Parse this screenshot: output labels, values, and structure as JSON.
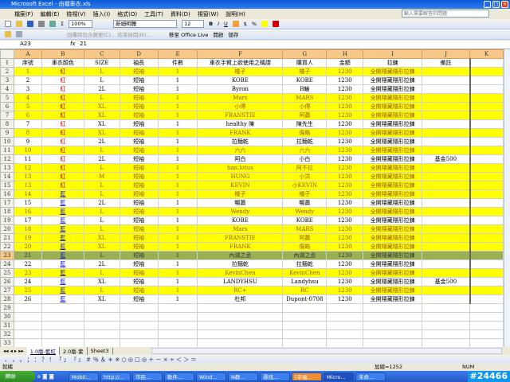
{
  "window": {
    "title": "Microsoft Excel - 由檔車衣.xls"
  },
  "menu": [
    "檔案(F)",
    "編輯(E)",
    "檢視(V)",
    "插入(I)",
    "格式(O)",
    "工具(T)",
    "資料(D)",
    "視窗(W)",
    "說明(H)"
  ],
  "ask_placeholder": "輸入需要解答的問題",
  "toolbar": {
    "zoom": "100%",
    "font": "新細明體",
    "size": "12",
    "bold": "B",
    "italic": "I",
    "underline": "U",
    "currency": "$",
    "percent": "%"
  },
  "toolbar2": {
    "reply": "回覆時包含變更(C)... 結束檢閱(N)...",
    "office_live": "移至 Office Live",
    "open": "開啟",
    "save": "儲存"
  },
  "formula_bar": {
    "cell_ref": "A23",
    "fx": "fx",
    "value": "21"
  },
  "columns": [
    "A",
    "B",
    "C",
    "D",
    "E",
    "F",
    "G",
    "H",
    "I",
    "J",
    "K"
  ],
  "headers": [
    "序號",
    "車衣顏色",
    "SIZE",
    "袖長",
    "件數",
    "車衣手臂上欲使用之稱謂",
    "購買人",
    "金額",
    "拉鍊",
    "備註"
  ],
  "rows": [
    [
      "1",
      "紅",
      "L",
      "短袖",
      "1",
      "橘子",
      "橘子",
      "1230",
      "全開隱藏隱形拉鍊",
      ""
    ],
    [
      "2",
      "紅",
      "L",
      "短袖",
      "1",
      "KOBE",
      "KOBE",
      "1230",
      "全開隱藏隱形拉鍊",
      ""
    ],
    [
      "3",
      "紅",
      "2L",
      "短袖",
      "1",
      "Byron",
      "B輪",
      "1230",
      "全開隱藏隱形拉鍊",
      ""
    ],
    [
      "4",
      "紅",
      "L",
      "短袖",
      "1",
      "Mars",
      "MARS",
      "1230",
      "全開隱藏隱形拉鍊",
      ""
    ],
    [
      "5",
      "紅",
      "XL",
      "短袖",
      "1",
      "小傅",
      "小傅",
      "1230",
      "全開隱藏隱形拉鍊",
      ""
    ],
    [
      "6",
      "紅",
      "XL",
      "短袖",
      "1",
      "FRANSTIE",
      "阿蕭",
      "1230",
      "全開隱藏隱形拉鍊",
      ""
    ],
    [
      "7",
      "紅",
      "XL",
      "短袖",
      "1",
      "healthy 陳",
      "陳先生",
      "1230",
      "全開隱藏隱形拉鍊",
      ""
    ],
    [
      "8",
      "紅",
      "XL",
      "短袖",
      "1",
      "FRANK",
      "傷皓",
      "1230",
      "全開隱藏隱形拉鍊",
      ""
    ],
    [
      "9",
      "紅",
      "2L",
      "短袖",
      "1",
      "拉麵乾",
      "拉麵乾",
      "1230",
      "全開隱藏隱形拉鍊",
      ""
    ],
    [
      "10",
      "紅",
      "L",
      "短袖",
      "1",
      "六六",
      "六六",
      "1230",
      "全開隱藏隱形拉鍊",
      ""
    ],
    [
      "11",
      "紅",
      "2L",
      "短袖",
      "1",
      "阿白",
      "小白",
      "1230",
      "全開隱藏隱形拉鍊",
      "基金500"
    ],
    [
      "12",
      "紅",
      "L",
      "短袖",
      "1",
      "han.lotus",
      "阿不拉",
      "1230",
      "全開隱藏隱形拉鍊",
      ""
    ],
    [
      "13",
      "紅",
      "M",
      "短袖",
      "1",
      "HUNG",
      "小洪",
      "1230",
      "全開隱藏隱形拉鍊",
      ""
    ],
    [
      "13",
      "紅",
      "L",
      "短袖",
      "1",
      "KEVIN",
      "小KEVIN",
      "1230",
      "全開隱藏隱形拉鍊",
      ""
    ],
    [
      "14",
      "藍",
      "L",
      "短袖",
      "1",
      "橘子",
      "橘子",
      "1230",
      "全開隱藏隱形拉鍊",
      ""
    ],
    [
      "15",
      "藍",
      "2L",
      "短袖",
      "1",
      "暢蕭",
      "暢蕭",
      "1230",
      "全開隱藏隱形拉鍊",
      ""
    ],
    [
      "16",
      "藍",
      "L",
      "短袖",
      "1",
      "Wendy",
      "Wendy",
      "1230",
      "全開隱藏隱形拉鍊",
      ""
    ],
    [
      "17",
      "藍",
      "L",
      "短袖",
      "1",
      "KOBE",
      "KOBE",
      "1230",
      "全開隱藏隱形拉鍊",
      ""
    ],
    [
      "18",
      "藍",
      "L",
      "短袖",
      "1",
      "Mars",
      "MARS",
      "1230",
      "全開隱藏隱形拉鍊",
      ""
    ],
    [
      "19",
      "藍",
      "XL",
      "短袖",
      "1",
      "FRANSTIE",
      "阿蕭",
      "1230",
      "全開隱藏隱形拉鍊",
      ""
    ],
    [
      "20",
      "藍",
      "XL",
      "短袖",
      "1",
      "FRANK",
      "傷皓",
      "1230",
      "全開隱藏隱形拉鍊",
      ""
    ],
    [
      "21",
      "藍",
      "L",
      "短袖",
      "1",
      "內湖之丞",
      "內湖之丞",
      "1230",
      "全開隱藏隱形拉鍊",
      ""
    ],
    [
      "22",
      "藍",
      "2L",
      "短袖",
      "1",
      "拉麵乾",
      "拉麵乾",
      "1230",
      "全開隱藏隱形拉鍊",
      ""
    ],
    [
      "23",
      "藍",
      "L",
      "短袖",
      "1",
      "KevinChen",
      "KevinChen",
      "1230",
      "全開隱藏隱形拉鍊",
      ""
    ],
    [
      "24",
      "藍",
      "XL",
      "短袖",
      "1",
      "LANDYHSU",
      "Landyhsu",
      "1230",
      "全開隱藏隱形拉鍊",
      "基金500"
    ],
    [
      "25",
      "藍",
      "L",
      "短袖",
      "1",
      "RC+",
      "RC",
      "1230",
      "全開隱藏隱形拉鍊",
      ""
    ],
    [
      "26",
      "藍",
      "XL",
      "短袖",
      "1",
      "杜邦",
      "Dupont-0708",
      "1230",
      "全開隱藏隱形拉鍊",
      ""
    ]
  ],
  "row_styles": [
    "hl",
    "",
    "",
    "hl",
    "hl",
    "hl",
    "",
    "hl",
    "",
    "hl",
    "",
    "hl",
    "hl",
    "hl",
    "hl",
    "",
    "hl",
    "",
    "hl",
    "hl",
    "hl",
    "sel",
    "",
    "hl",
    "",
    "hl",
    ""
  ],
  "empty_rows": [
    "29",
    "30",
    "31",
    "32",
    "33"
  ],
  "sheet_tabs": [
    "1.0版-藍紅",
    "2.0版-紫",
    "Sheet3"
  ],
  "status": {
    "ready": "就緒",
    "sum": "加總=1252",
    "num": "NUM"
  },
  "taskbar": {
    "start": "開始",
    "tasks": [
      "Mobil...",
      "http://...",
      "市民...",
      "軟件...",
      "Wind...",
      "N群...",
      "尋找...",
      "[幸福...",
      "Micro...",
      "未命..."
    ],
    "badge": "#24466"
  },
  "colors": {
    "highlight": "#ffff00",
    "selected_row": "#9bb055",
    "red": "#c00000",
    "blue": "#2020c0"
  }
}
